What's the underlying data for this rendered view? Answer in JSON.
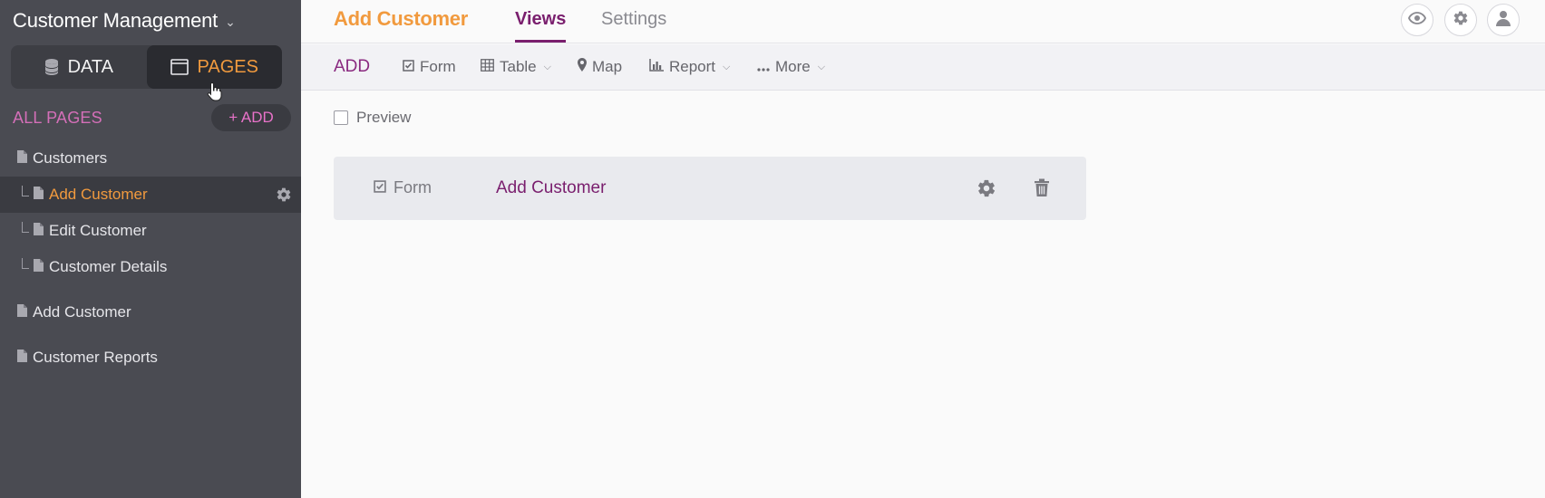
{
  "sidebar": {
    "app_title": "Customer Management",
    "segments": {
      "data": "DATA",
      "pages": "PAGES"
    },
    "section_title": "ALL PAGES",
    "add_label": "+ ADD",
    "items": [
      {
        "label": "Customers"
      },
      {
        "label": "Add Customer"
      },
      {
        "label": "Edit Customer"
      },
      {
        "label": "Customer Details"
      },
      {
        "label": "Add Customer"
      },
      {
        "label": "Customer Reports"
      }
    ]
  },
  "header": {
    "page_name": "Add Customer",
    "tabs": {
      "views": "Views",
      "settings": "Settings"
    }
  },
  "toolbar": {
    "add_label": "ADD",
    "form": "Form",
    "table": "Table",
    "map": "Map",
    "report": "Report",
    "more": "More"
  },
  "content": {
    "preview_label": "Preview",
    "view": {
      "type": "Form",
      "name": "Add Customer"
    }
  },
  "colors": {
    "sidebar_bg": "#4a4b52",
    "accent_orange": "#f19a3e",
    "accent_purple": "#7a1f6e",
    "pink": "#d46fb8"
  }
}
